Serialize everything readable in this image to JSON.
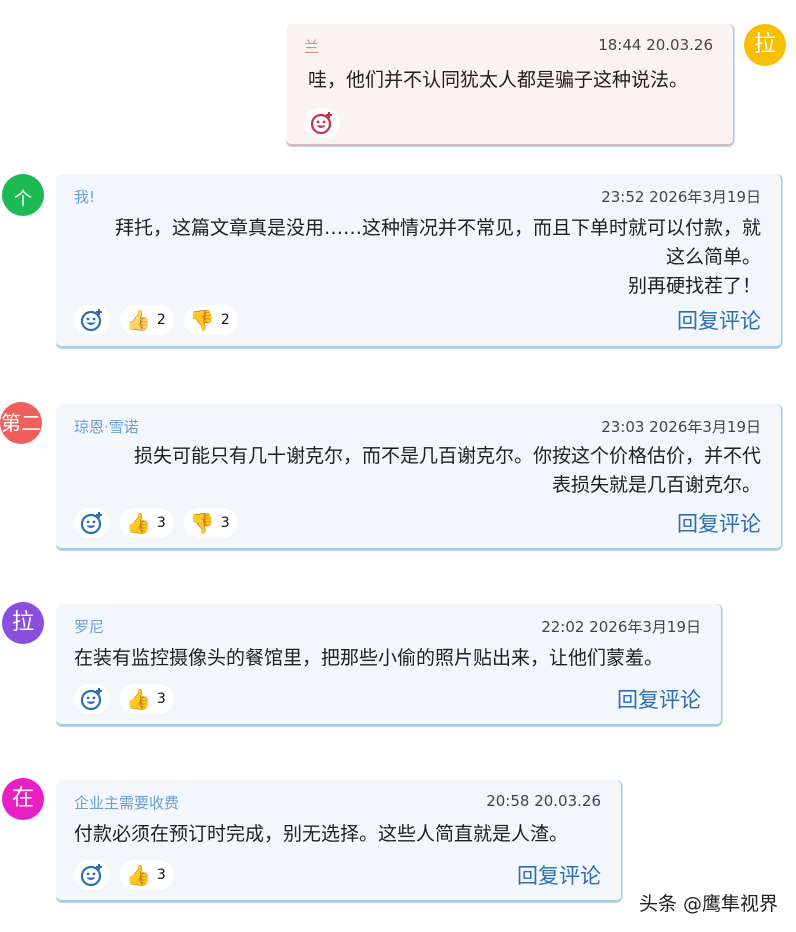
{
  "colors": {
    "bubble_bg": "#f3f7fb",
    "self_bubble_bg": "#fbf3f2",
    "author": "#6a9fcf",
    "reply_link": "#2a6eb5"
  },
  "comments": [
    {
      "avatar_text": "拉",
      "avatar_color": "#f6c000",
      "author": "兰",
      "time": "18:44 20.03.26",
      "text": "哇，他们并不认同犹太人都是骗子这种说法。",
      "reactions": []
    },
    {
      "avatar_text": "个",
      "avatar_color": "#1db954",
      "author": "我!",
      "time": "23:52 2026年3月19日",
      "text_lines": [
        "拜托，这篇文章真是没用……这种情况并不常见，而且下单时就可以付款，就",
        "这么简单。",
        "别再硬找茬了！"
      ],
      "likes": "2",
      "dislikes": "2",
      "reply": "回复评论"
    },
    {
      "avatar_text": "第二",
      "avatar_color": "#f0605a",
      "author": "琼恩·雪诺",
      "time": "23:03 2026年3月19日",
      "text_lines": [
        "损失可能只有几十谢克尔，而不是几百谢克尔。你按这个价格估价，并不代",
        "表损失就是几百谢克尔。"
      ],
      "likes": "3",
      "dislikes": "3",
      "reply": "回复评论"
    },
    {
      "avatar_text": "拉",
      "avatar_color": "#8b4fe0",
      "author": "罗尼",
      "time": "22:02 2026年3月19日",
      "text": "在装有监控摄像头的餐馆里，把那些小偷的照片贴出来，让他们蒙羞。",
      "likes": "3",
      "reply": "回复评论"
    },
    {
      "avatar_text": "在",
      "avatar_color": "#e81fc4",
      "author": "企业主需要收费",
      "time": "20:58 20.03.26",
      "text": "付款必须在预订时完成，别无选择。这些人简直就是人渣。",
      "likes": "3",
      "reply": "回复评论"
    }
  ],
  "watermark": "头条 @鹰隼视界"
}
